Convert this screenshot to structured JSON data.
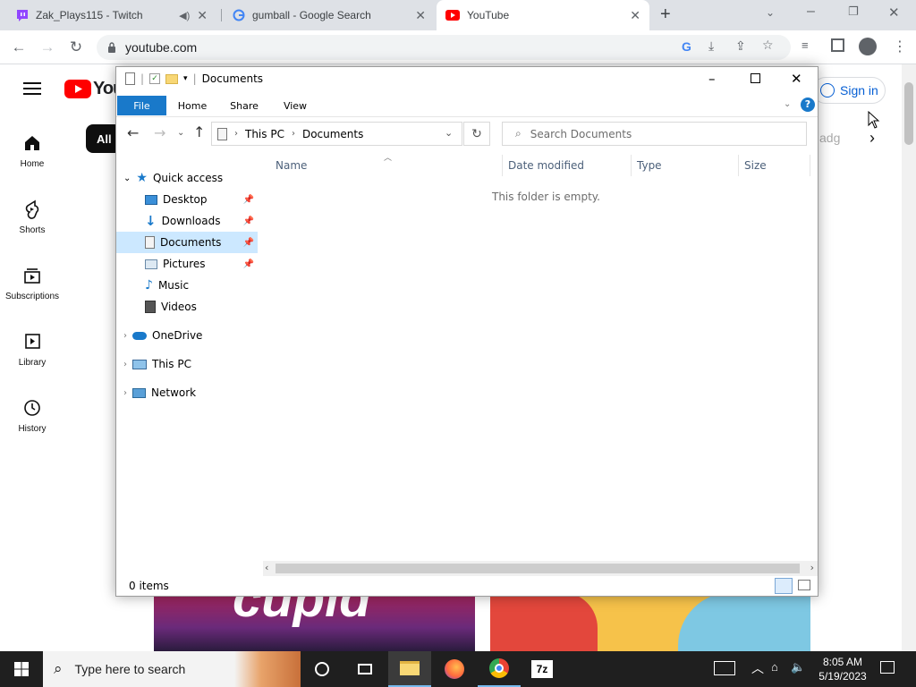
{
  "browser": {
    "tabs": [
      {
        "title": "Zak_Plays115 - Twitch"
      },
      {
        "title": "gumball - Google Search"
      },
      {
        "title": "YouTube"
      }
    ],
    "url": "youtube.com"
  },
  "youtube": {
    "logo_text": "You",
    "sign_in": "Sign in",
    "chip_all": "All",
    "chip_partial": "adg",
    "sidebar": [
      {
        "label": "Home"
      },
      {
        "label": "Shorts"
      },
      {
        "label": "Subscriptions"
      },
      {
        "label": "Library"
      },
      {
        "label": "History"
      }
    ],
    "thumb_text": "cupid"
  },
  "explorer": {
    "title": "Documents",
    "ribbon_tabs": [
      "File",
      "Home",
      "Share",
      "View"
    ],
    "breadcrumb": [
      "This PC",
      "Documents"
    ],
    "search_placeholder": "Search Documents",
    "tree": {
      "quick_access": "Quick access",
      "qa_items": [
        {
          "label": "Desktop"
        },
        {
          "label": "Downloads"
        },
        {
          "label": "Documents"
        },
        {
          "label": "Pictures"
        },
        {
          "label": "Music"
        },
        {
          "label": "Videos"
        }
      ],
      "onedrive": "OneDrive",
      "this_pc": "This PC",
      "network": "Network"
    },
    "columns": [
      "Name",
      "Date modified",
      "Type",
      "Size"
    ],
    "empty_message": "This folder is empty.",
    "status": "0 items"
  },
  "taskbar": {
    "search_placeholder": "Type here to search",
    "time": "8:05 AM",
    "date": "5/19/2023"
  },
  "colors": {
    "accent_file_tab": "#1979ca",
    "selection": "#cce8ff",
    "youtube_red": "#ff0000",
    "taskbar": "#1f1f1f"
  }
}
